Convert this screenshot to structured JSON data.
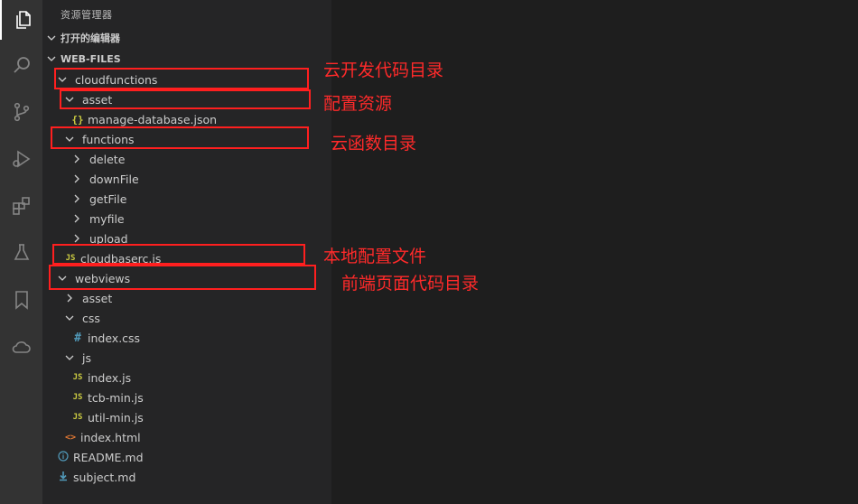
{
  "explorer": {
    "title": "资源管理器",
    "open_editors_label": "打开的编辑器",
    "workspace_label": "WEB-FILES"
  },
  "tree": [
    {
      "label": "cloudfunctions",
      "type": "folder",
      "expanded": true
    },
    {
      "label": "asset",
      "type": "folder",
      "expanded": true
    },
    {
      "label": "manage-database.json",
      "type": "json"
    },
    {
      "label": "functions",
      "type": "folder",
      "expanded": true
    },
    {
      "label": "delete",
      "type": "folder",
      "expanded": false
    },
    {
      "label": "downFile",
      "type": "folder",
      "expanded": false
    },
    {
      "label": "getFile",
      "type": "folder",
      "expanded": false
    },
    {
      "label": "myfile",
      "type": "folder",
      "expanded": false
    },
    {
      "label": "upload",
      "type": "folder",
      "expanded": false
    },
    {
      "label": "cloudbaserc.js",
      "type": "js"
    },
    {
      "label": "webviews",
      "type": "folder",
      "expanded": true
    },
    {
      "label": "asset",
      "type": "folder",
      "expanded": false
    },
    {
      "label": "css",
      "type": "folder",
      "expanded": true
    },
    {
      "label": "index.css",
      "type": "css"
    },
    {
      "label": "js",
      "type": "folder",
      "expanded": true
    },
    {
      "label": "index.js",
      "type": "js"
    },
    {
      "label": "tcb-min.js",
      "type": "js"
    },
    {
      "label": "util-min.js",
      "type": "js"
    },
    {
      "label": "index.html",
      "type": "html"
    },
    {
      "label": "README.md",
      "type": "info"
    },
    {
      "label": "subject.md",
      "type": "md"
    }
  ],
  "icons": {
    "js": "JS",
    "json": "{}",
    "css": "#",
    "html": "<>",
    "js_color": "#cbcb41",
    "json_color": "#cbcb41",
    "css_color": "#519aba",
    "html_color": "#e37933",
    "info_color": "#519aba",
    "md_color": "#519aba"
  },
  "annotations": {
    "cloudfunctions": "云开发代码目录",
    "asset": "配置资源",
    "functions": "云函数目录",
    "config": "本地配置文件",
    "webviews": "前端页面代码目录"
  },
  "colors": {
    "highlight": "#ff1f1f",
    "annotation_text": "#ff2a2a"
  }
}
